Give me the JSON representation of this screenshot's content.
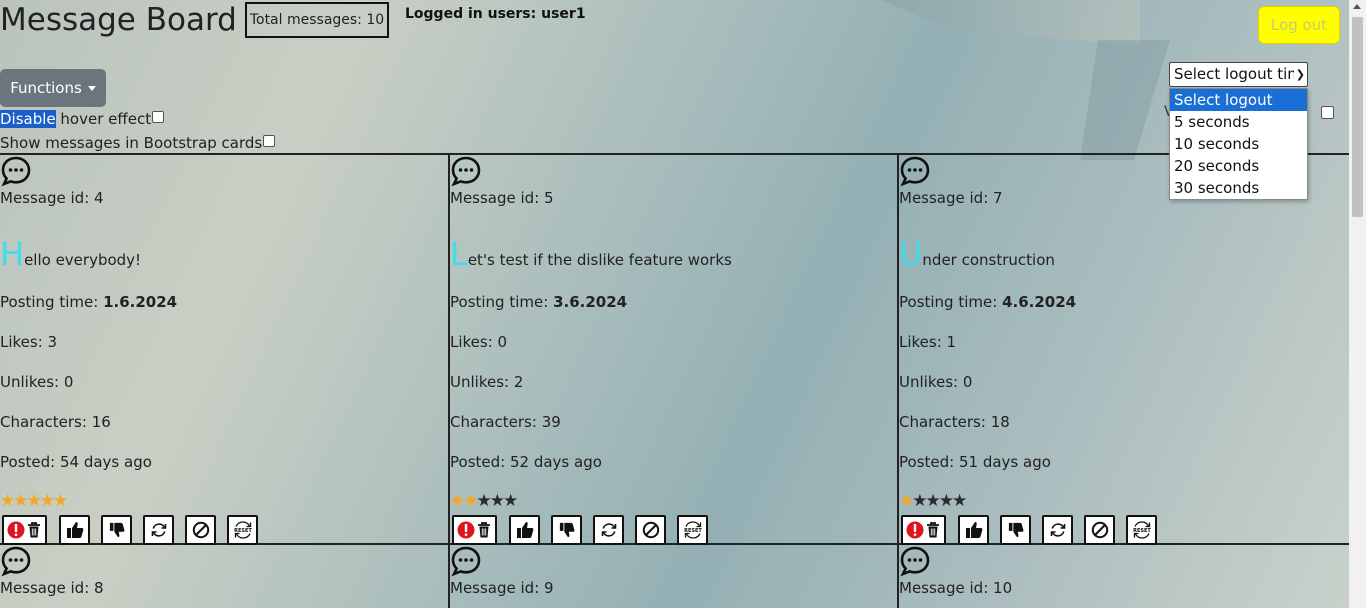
{
  "header": {
    "title": "Message Board",
    "total_messages": "Total messages: 10",
    "logged_in": "Logged in users: user1",
    "logout_label": "Log out"
  },
  "logout_select": {
    "current": "Select logout tim",
    "options": [
      "Select logout time",
      "5 seconds",
      "10 seconds",
      "20 seconds",
      "30 seconds"
    ],
    "partial_label": "V"
  },
  "controls": {
    "functions_label": "Functions",
    "disable_hl": "Disable",
    "disable_rest": " hover effect",
    "bootstrap_label": "Show messages in Bootstrap cards"
  },
  "labels": {
    "posting_time": "Posting time: ",
    "likes": "Likes: ",
    "unlikes": "Unlikes: ",
    "characters": "Characters: ",
    "posted": "Posted: "
  },
  "colors": {
    "accent_first_letter": "#3fdcec",
    "star_on": "#f5a623",
    "logout_bg": "#ffff00",
    "functions_bg": "#6c757d"
  },
  "cards": [
    {
      "id": "Message id: 4",
      "first": "H",
      "rest": "ello everybody!",
      "date": "1.6.2024",
      "likes": "3",
      "unlikes": "0",
      "chars": "16",
      "posted": "54 days ago",
      "stars": 5
    },
    {
      "id": "Message id: 5",
      "first": "L",
      "rest": "et's test if the dislike feature works",
      "date": "3.6.2024",
      "likes": "0",
      "unlikes": "2",
      "chars": "39",
      "posted": "52 days ago",
      "stars": 2
    },
    {
      "id": "Message id: 7",
      "first": "U",
      "rest": "nder construction",
      "date": "4.6.2024",
      "likes": "1",
      "unlikes": "0",
      "chars": "18",
      "posted": "51 days ago",
      "stars": 1
    },
    {
      "id": "Message id: 8"
    },
    {
      "id": "Message id: 9"
    },
    {
      "id": "Message id: 10"
    }
  ]
}
